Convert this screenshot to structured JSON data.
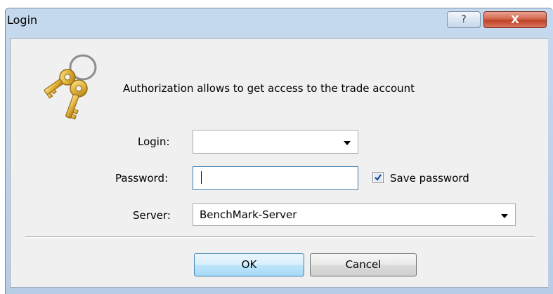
{
  "window": {
    "title": "Login",
    "help_glyph": "?",
    "close_glyph": "X"
  },
  "header": {
    "icon": "keys-icon",
    "message": "Authorization allows to get access to the trade account"
  },
  "form": {
    "login": {
      "label": "Login:",
      "value": ""
    },
    "password": {
      "label": "Password:",
      "value": ""
    },
    "save_password": {
      "label": "Save password",
      "checked": true
    },
    "server": {
      "label": "Server:",
      "value": "BenchMark-Server"
    }
  },
  "buttons": {
    "ok": "OK",
    "cancel": "Cancel"
  },
  "colors": {
    "title_bar": "#c0d5ec",
    "close_button": "#c9523a",
    "client_bg": "#f0f0f0",
    "default_button_border": "#3c7fb1"
  }
}
